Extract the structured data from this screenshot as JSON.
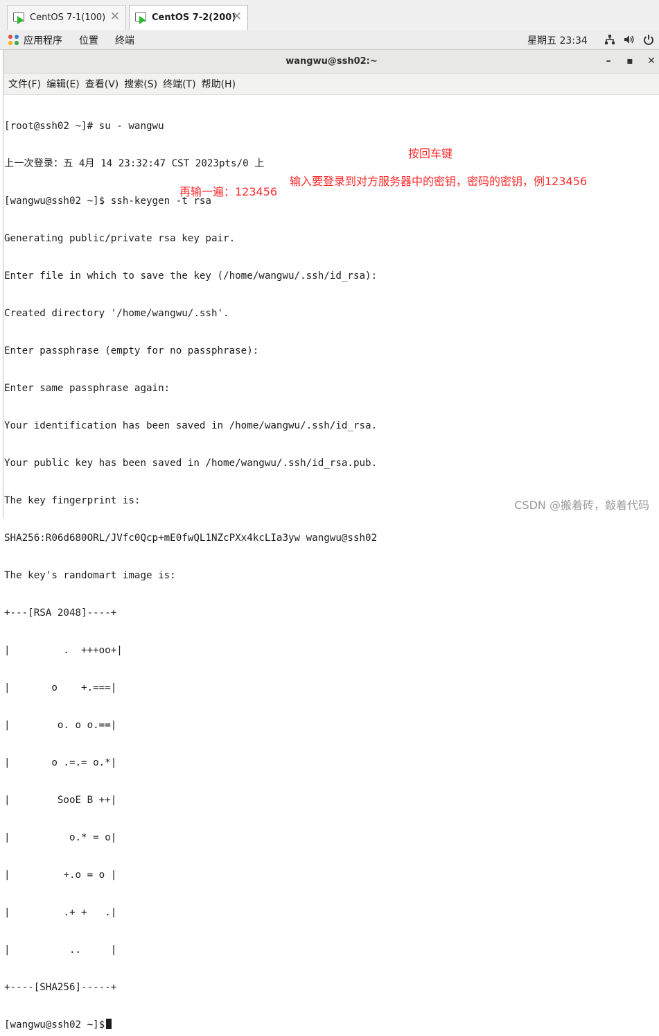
{
  "tabs": [
    {
      "label": "CentOS 7-1(100)",
      "active": false
    },
    {
      "label": "CentOS 7-2(200)",
      "active": true
    }
  ],
  "topbar": {
    "applications": "应用程序",
    "places": "位置",
    "terminal": "终端",
    "clock": "星期五 23:34",
    "icons": [
      "network-icon",
      "volume-icon",
      "power-icon"
    ]
  },
  "window": {
    "title": "wangwu@ssh02:~",
    "controls": {
      "minimize": "–",
      "maximize": "▪",
      "close": "✕"
    }
  },
  "menu": [
    "文件(F)",
    "编辑(E)",
    "查看(V)",
    "搜索(S)",
    "终端(T)",
    "帮助(H)"
  ],
  "terminal_lines": [
    "[root@ssh02 ~]# su - wangwu",
    "上一次登录：五 4月 14 23:32:47 CST 2023pts/0 上",
    "[wangwu@ssh02 ~]$ ssh-keygen -t rsa",
    "Generating public/private rsa key pair.",
    "Enter file in which to save the key (/home/wangwu/.ssh/id_rsa):",
    "Created directory '/home/wangwu/.ssh'.",
    "Enter passphrase (empty for no passphrase):",
    "Enter same passphrase again:",
    "Your identification has been saved in /home/wangwu/.ssh/id_rsa.",
    "Your public key has been saved in /home/wangwu/.ssh/id_rsa.pub.",
    "The key fingerprint is:",
    "SHA256:R06d680ORL/JVfc0Qcp+mE0fwQL1NZcPXx4kcLIa3yw wangwu@ssh02",
    "The key's randomart image is:",
    "+---[RSA 2048]----+",
    "|         .  +++oo+|",
    "|       o    +.===|",
    "|        o. o o.==|",
    "|       o .=.= o.*|",
    "|        SooE B ++|",
    "|          o.* = o|",
    "|         +.o = o |",
    "|         .+ +   .|",
    "|          ..     |",
    "+----[SHA256]-----+",
    "[wangwu@ssh02 ~]$"
  ],
  "annotations": {
    "enter_key": "按回车键",
    "passphrase_hint": "输入要登录到对方服务器中的密钥，密码的密钥，例123456",
    "repeat": "再输一遍：123456"
  },
  "watermark": "CSDN @搬着砖，敲着代码",
  "colors": {
    "annotation": "#ff2a2a",
    "vm_play": "#2eb82e",
    "watermark": "#9b9b9b"
  }
}
